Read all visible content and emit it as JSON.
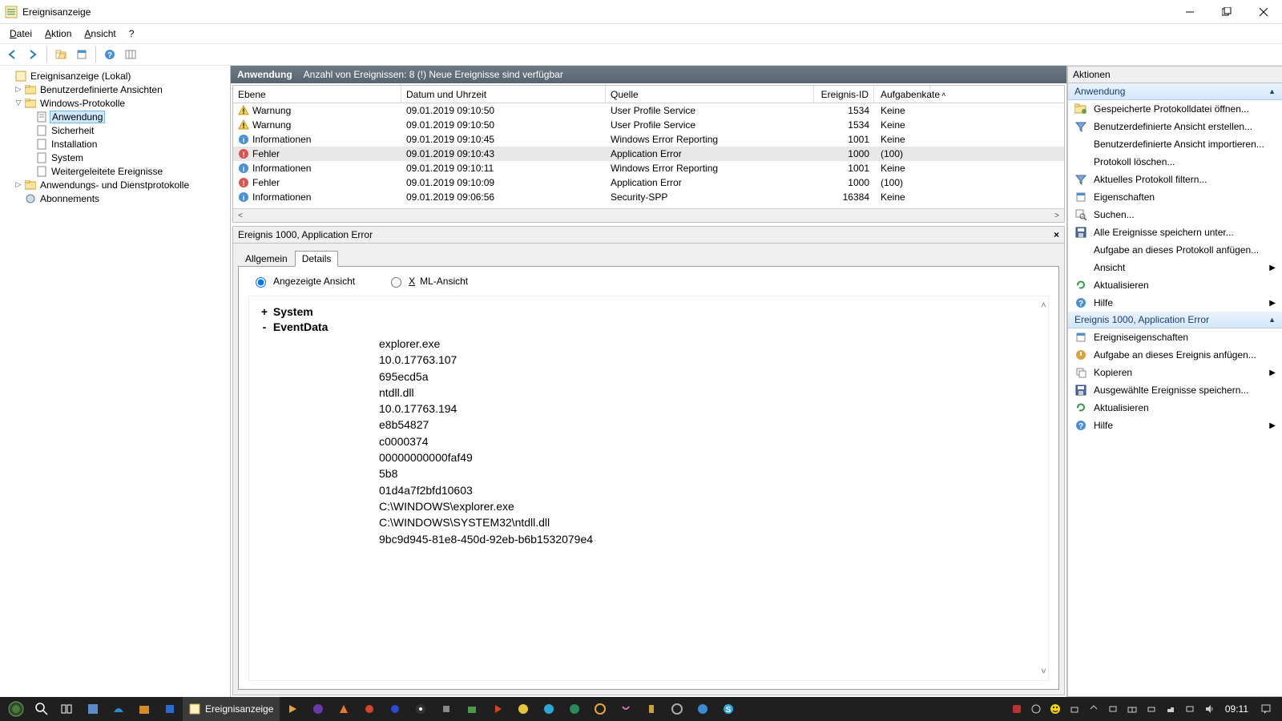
{
  "window": {
    "title": "Ereignisanzeige"
  },
  "menu": {
    "file": "Datei",
    "action": "Aktion",
    "view": "Ansicht",
    "help": "?"
  },
  "tree": {
    "root": "Ereignisanzeige (Lokal)",
    "custom": "Benutzerdefinierte Ansichten",
    "windows": "Windows-Protokolle",
    "win_items": {
      "app": "Anwendung",
      "sec": "Sicherheit",
      "inst": "Installation",
      "sys": "System",
      "fwd": "Weitergeleitete Ereignisse"
    },
    "appsvc": "Anwendungs- und Dienstprotokolle",
    "subs": "Abonnements"
  },
  "center": {
    "title": "Anwendung",
    "summary": "Anzahl von Ereignissen: 8 (!) Neue Ereignisse sind verfügbar",
    "columns": {
      "level": "Ebene",
      "date": "Datum und Uhrzeit",
      "source": "Quelle",
      "id": "Ereignis-ID",
      "task": "Aufgabenkate"
    },
    "rows": [
      {
        "level": "Warnung",
        "icon": "warn",
        "date": "09.01.2019 09:10:50",
        "source": "User Profile Service",
        "id": "1534",
        "task": "Keine"
      },
      {
        "level": "Warnung",
        "icon": "warn",
        "date": "09.01.2019 09:10:50",
        "source": "User Profile Service",
        "id": "1534",
        "task": "Keine"
      },
      {
        "level": "Informationen",
        "icon": "info",
        "date": "09.01.2019 09:10:45",
        "source": "Windows Error Reporting",
        "id": "1001",
        "task": "Keine"
      },
      {
        "level": "Fehler",
        "icon": "error",
        "date": "09.01.2019 09:10:43",
        "source": "Application Error",
        "id": "1000",
        "task": "(100)",
        "sel": true
      },
      {
        "level": "Informationen",
        "icon": "info",
        "date": "09.01.2019 09:10:11",
        "source": "Windows Error Reporting",
        "id": "1001",
        "task": "Keine"
      },
      {
        "level": "Fehler",
        "icon": "error",
        "date": "09.01.2019 09:10:09",
        "source": "Application Error",
        "id": "1000",
        "task": "(100)"
      },
      {
        "level": "Informationen",
        "icon": "info",
        "date": "09.01.2019 09:06:56",
        "source": "Security-SPP",
        "id": "16384",
        "task": "Keine"
      }
    ]
  },
  "detail": {
    "title": "Ereignis 1000, Application Error",
    "tabs": {
      "general": "Allgemein",
      "details": "Details"
    },
    "radios": {
      "friendly": "Angezeigte Ansicht",
      "xml": "XML-Ansicht"
    },
    "sys_label": "System",
    "evd_label": "EventData",
    "eventdata": [
      "explorer.exe",
      "10.0.17763.107",
      "695ecd5a",
      "ntdll.dll",
      "10.0.17763.194",
      "e8b54827",
      "c0000374",
      "00000000000faf49",
      "5b8",
      "01d4a7f2bfd10603",
      "C:\\WINDOWS\\explorer.exe",
      "C:\\WINDOWS\\SYSTEM32\\ntdll.dll",
      "9bc9d945-81e8-450d-92eb-b6b1532079e4"
    ]
  },
  "actions": {
    "header": "Aktionen",
    "group1": "Anwendung",
    "items1": [
      {
        "label": "Gespeicherte Protokolldatei öffnen...",
        "icon": "folder"
      },
      {
        "label": "Benutzerdefinierte Ansicht erstellen...",
        "icon": "filter"
      },
      {
        "label": "Benutzerdefinierte Ansicht importieren...",
        "icon": "blank"
      },
      {
        "label": "Protokoll löschen...",
        "icon": "blank"
      },
      {
        "label": "Aktuelles Protokoll filtern...",
        "icon": "filter"
      },
      {
        "label": "Eigenschaften",
        "icon": "props"
      },
      {
        "label": "Suchen...",
        "icon": "search"
      },
      {
        "label": "Alle Ereignisse speichern unter...",
        "icon": "save"
      },
      {
        "label": "Aufgabe an dieses Protokoll anfügen...",
        "icon": "blank"
      },
      {
        "label": "Ansicht",
        "icon": "blank",
        "arrow": true
      },
      {
        "label": "Aktualisieren",
        "icon": "refresh"
      },
      {
        "label": "Hilfe",
        "icon": "help",
        "arrow": true
      }
    ],
    "group2": "Ereignis 1000, Application Error",
    "items2": [
      {
        "label": "Ereigniseigenschaften",
        "icon": "props"
      },
      {
        "label": "Aufgabe an dieses Ereignis anfügen...",
        "icon": "task"
      },
      {
        "label": "Kopieren",
        "icon": "copy",
        "arrow": true
      },
      {
        "label": "Ausgewählte Ereignisse speichern...",
        "icon": "save"
      },
      {
        "label": "Aktualisieren",
        "icon": "refresh"
      },
      {
        "label": "Hilfe",
        "icon": "help",
        "arrow": true
      }
    ]
  },
  "taskbar": {
    "app": "Ereignisanzeige",
    "clock": "09:11"
  }
}
